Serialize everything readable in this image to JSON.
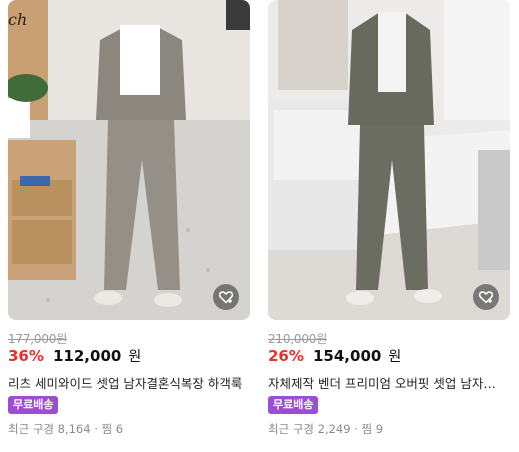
{
  "products": [
    {
      "original_price": "177,000원",
      "discount": "36%",
      "price": "112,000",
      "currency": "원",
      "title": "리츠 세미와이드 셋업 남자결혼식복장 하객룩",
      "badge": "무료배송",
      "recent_purchases": "최근 구경 8,164",
      "separator": "·",
      "wishlist": "찜 6",
      "wish_icon": "heart-plus-icon",
      "image_logo": "ch"
    },
    {
      "original_price": "210,000원",
      "discount": "26%",
      "price": "154,000",
      "currency": "원",
      "title": "자체제작 벤더 프리미엄 오버핏 셋업 남자하객룩",
      "badge": "무료배송",
      "recent_purchases": "최근 구경 2,249",
      "separator": "·",
      "wishlist": "찜 9",
      "wish_icon": "heart-plus-icon"
    }
  ],
  "colors": {
    "discount": "#e3322e",
    "badge_bg": "#9b4dd4",
    "muted": "#8a8a8a"
  }
}
